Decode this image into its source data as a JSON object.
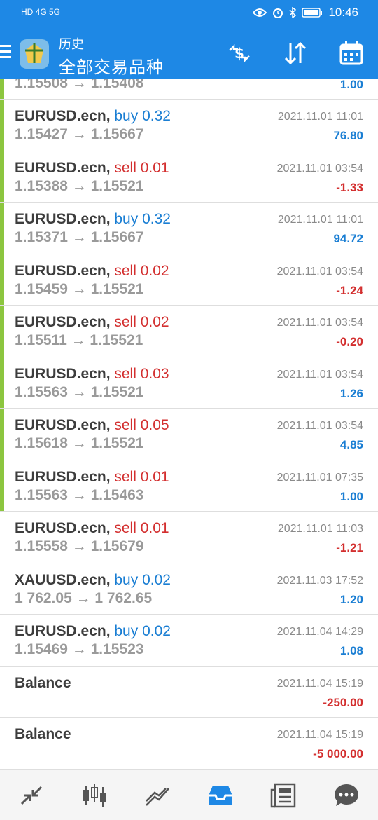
{
  "status": {
    "left_text": "HD 4G 5G",
    "time": "10:46"
  },
  "header": {
    "title_small": "历史",
    "title_big": "全部交易品种",
    "actions": [
      "deposit-icon",
      "sort-icon",
      "calendar-icon"
    ]
  },
  "deals": [
    {
      "symbol": "",
      "dir": "",
      "lot": "",
      "prices": "1.15508 → 1.15408",
      "date": "",
      "profit": "1.00",
      "sign": "pos",
      "bar": true,
      "partial": true
    },
    {
      "symbol": "EURUSD.ecn,",
      "dir": "buy",
      "lot": "0.32",
      "prices": "1.15427 → 1.15667",
      "date": "2021.11.01 11:01",
      "profit": "76.80",
      "sign": "pos",
      "bar": true
    },
    {
      "symbol": "EURUSD.ecn,",
      "dir": "sell",
      "lot": "0.01",
      "prices": "1.15388 → 1.15521",
      "date": "2021.11.01 03:54",
      "profit": "-1.33",
      "sign": "neg",
      "bar": true
    },
    {
      "symbol": "EURUSD.ecn,",
      "dir": "buy",
      "lot": "0.32",
      "prices": "1.15371 → 1.15667",
      "date": "2021.11.01 11:01",
      "profit": "94.72",
      "sign": "pos",
      "bar": true
    },
    {
      "symbol": "EURUSD.ecn,",
      "dir": "sell",
      "lot": "0.02",
      "prices": "1.15459 → 1.15521",
      "date": "2021.11.01 03:54",
      "profit": "-1.24",
      "sign": "neg",
      "bar": true
    },
    {
      "symbol": "EURUSD.ecn,",
      "dir": "sell",
      "lot": "0.02",
      "prices": "1.15511 → 1.15521",
      "date": "2021.11.01 03:54",
      "profit": "-0.20",
      "sign": "neg",
      "bar": true
    },
    {
      "symbol": "EURUSD.ecn,",
      "dir": "sell",
      "lot": "0.03",
      "prices": "1.15563 → 1.15521",
      "date": "2021.11.01 03:54",
      "profit": "1.26",
      "sign": "pos",
      "bar": true
    },
    {
      "symbol": "EURUSD.ecn,",
      "dir": "sell",
      "lot": "0.05",
      "prices": "1.15618 → 1.15521",
      "date": "2021.11.01 03:54",
      "profit": "4.85",
      "sign": "pos",
      "bar": true
    },
    {
      "symbol": "EURUSD.ecn,",
      "dir": "sell",
      "lot": "0.01",
      "prices": "1.15563 → 1.15463",
      "date": "2021.11.01 07:35",
      "profit": "1.00",
      "sign": "pos",
      "bar": true
    },
    {
      "symbol": "EURUSD.ecn,",
      "dir": "sell",
      "lot": "0.01",
      "prices": "1.15558 → 1.15679",
      "date": "2021.11.01 11:03",
      "profit": "-1.21",
      "sign": "neg",
      "bar": false
    },
    {
      "symbol": "XAUUSD.ecn,",
      "dir": "buy",
      "lot": "0.02",
      "prices": "1 762.05 → 1 762.65",
      "date": "2021.11.03 17:52",
      "profit": "1.20",
      "sign": "pos",
      "bar": false
    },
    {
      "symbol": "EURUSD.ecn,",
      "dir": "buy",
      "lot": "0.02",
      "prices": "1.15469 → 1.15523",
      "date": "2021.11.04 14:29",
      "profit": "1.08",
      "sign": "pos",
      "bar": false
    },
    {
      "symbol": "Balance",
      "dir": "",
      "lot": "",
      "prices": "",
      "date": "2021.11.04 15:19",
      "profit": "-250.00",
      "sign": "neg",
      "bar": false
    },
    {
      "symbol": "Balance",
      "dir": "",
      "lot": "",
      "prices": "",
      "date": "2021.11.04 15:19",
      "profit": "-5 000.00",
      "sign": "neg",
      "bar": false
    }
  ],
  "bottom_nav": [
    {
      "icon": "quotes-icon",
      "active": false
    },
    {
      "icon": "chart-icon",
      "active": false
    },
    {
      "icon": "trade-icon",
      "active": false
    },
    {
      "icon": "history-icon",
      "active": true
    },
    {
      "icon": "news-icon",
      "active": false
    },
    {
      "icon": "chat-icon",
      "active": false
    }
  ],
  "colors": {
    "accent": "#1e88e5",
    "buy": "#1a7ed3",
    "sell": "#d32f2f",
    "bar": "#8cc63f"
  }
}
